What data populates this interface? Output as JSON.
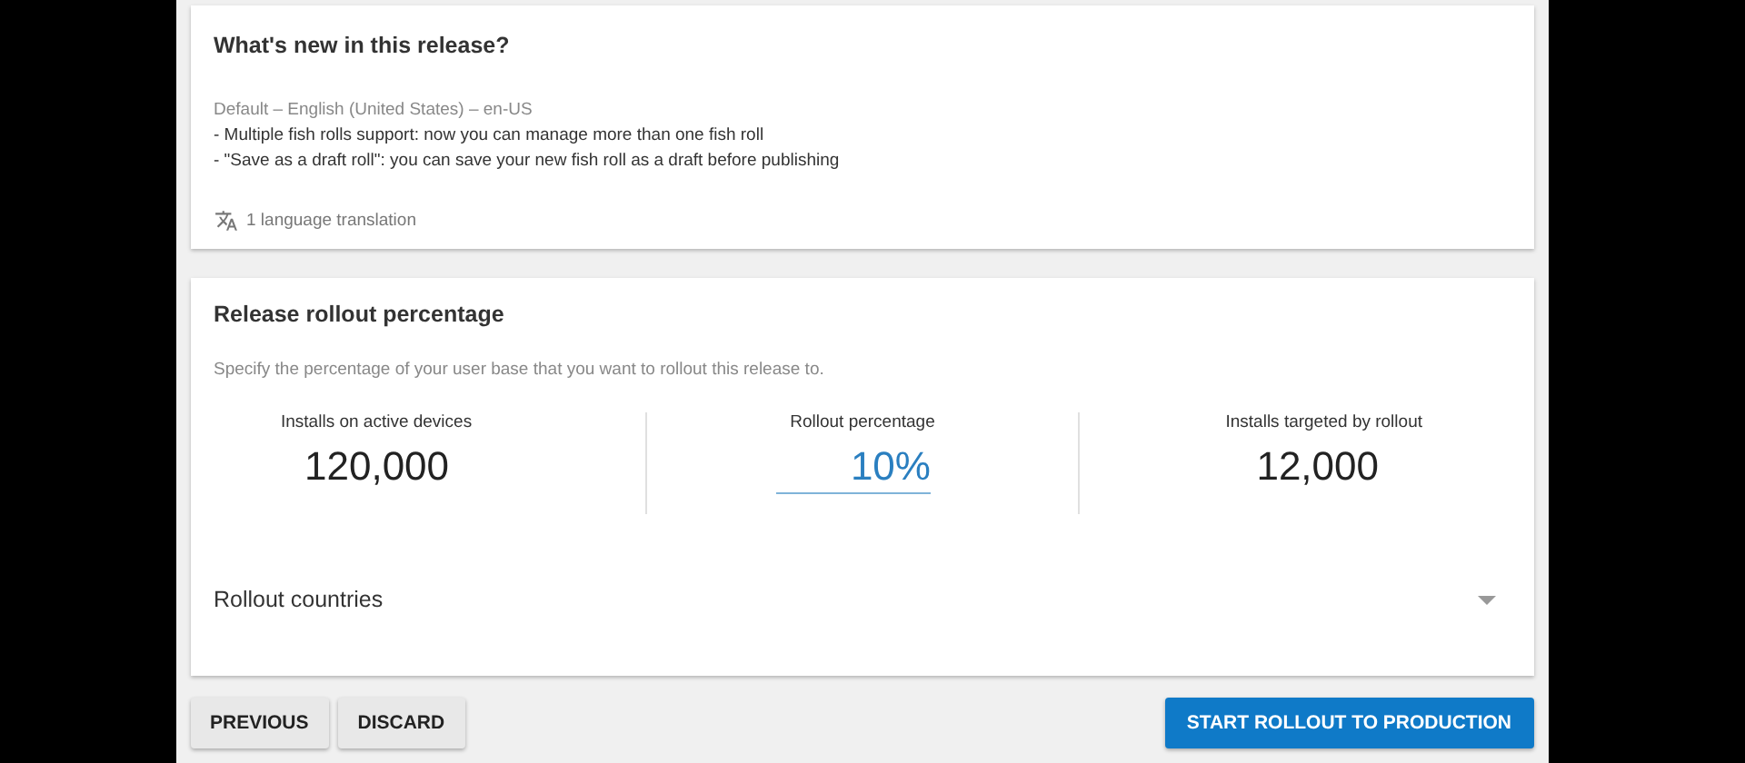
{
  "whats_new": {
    "title": "What's new in this release?",
    "language": "Default – English (United States) – en-US",
    "notes": [
      "- Multiple fish rolls support: now you can manage more than one fish roll",
      "- \"Save as a draft roll\": you can save your new fish roll as a draft before publishing"
    ],
    "translations": "1 language translation"
  },
  "rollout": {
    "title": "Release rollout percentage",
    "description": "Specify the percentage of your user base that you want to rollout this release to.",
    "stats": [
      {
        "kind": "text",
        "label": "Installs on active devices",
        "value": "120,000"
      },
      {
        "kind": "input",
        "label": "Rollout percentage",
        "value": "10%"
      },
      {
        "kind": "text",
        "label": "Installs targeted by rollout",
        "value": "12,000"
      }
    ],
    "countries": {
      "label": "Rollout countries"
    }
  },
  "buttons": [
    {
      "label": "PREVIOUS",
      "kind": "secondary"
    },
    {
      "label": "DISCARD",
      "kind": "secondary"
    },
    {
      "label": "START ROLLOUT TO PRODUCTION",
      "kind": "primary"
    }
  ]
}
